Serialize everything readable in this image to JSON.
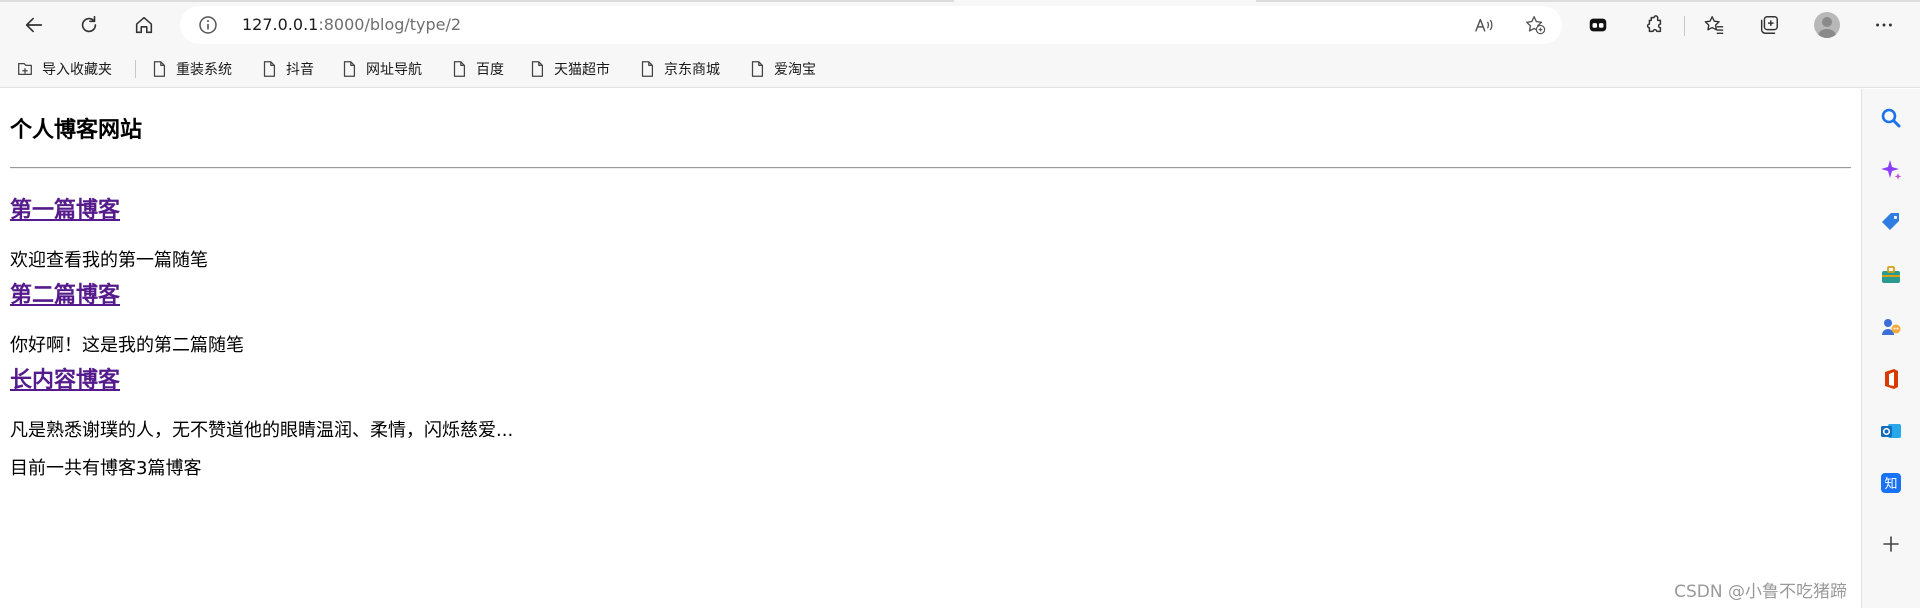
{
  "browser": {
    "url_host": "127.0.0.1",
    "url_path": ":8000/blog/type/2"
  },
  "favorites": [
    {
      "label": "导入收藏夹",
      "icon": "import-icon"
    },
    {
      "label": "重装系统",
      "icon": "page-icon"
    },
    {
      "label": "抖音",
      "icon": "page-icon"
    },
    {
      "label": "网址导航",
      "icon": "page-icon"
    },
    {
      "label": "百度",
      "icon": "page-icon"
    },
    {
      "label": "天猫超市",
      "icon": "page-icon"
    },
    {
      "label": "京东商城",
      "icon": "page-icon"
    },
    {
      "label": "爱淘宝",
      "icon": "page-icon"
    }
  ],
  "page": {
    "site_title": "个人博客网站",
    "posts": [
      {
        "title": "第一篇博客",
        "body": "欢迎查看我的第一篇随笔"
      },
      {
        "title": "第二篇博客",
        "body": "你好啊！这是我的第二篇随笔"
      },
      {
        "title": "长内容博客",
        "body": "凡是熟悉谢璞的人，无不赞道他的眼睛温润、柔情，闪烁慈爱..."
      }
    ],
    "summary": "目前一共有博客3篇博客"
  },
  "watermark": "CSDN @小鲁不吃猪蹄",
  "colors": {
    "link_visited": "#551a8b",
    "search_blue": "#1a73e8",
    "copilot_purple": "#8b3dff",
    "office_red": "#d83b01",
    "outlook_blue": "#0f6cbd",
    "zhihu_blue": "#1772f6"
  },
  "sidebar_icons": [
    "search-icon",
    "copilot-icon",
    "shopping-tag-icon",
    "tools-icon",
    "games-icon",
    "office-icon",
    "outlook-icon",
    "zhihu-icon",
    "add-icon"
  ]
}
